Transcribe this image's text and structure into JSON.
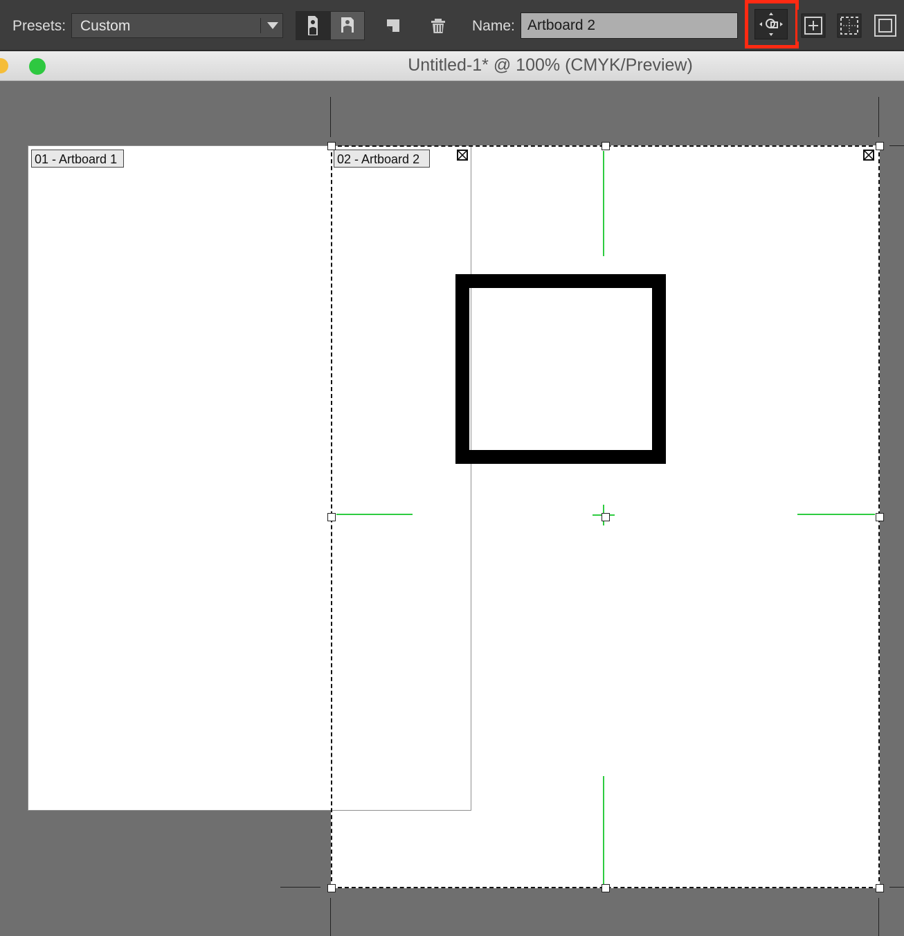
{
  "toolbar": {
    "presets_label": "Presets:",
    "presets_value": "Custom",
    "name_label": "Name:",
    "name_value": "Artboard 2",
    "highlight_color": "#ff2a12",
    "orientation_buttons": [
      "portrait-icon",
      "landscape-icon"
    ],
    "tools": [
      "new-artboard-icon",
      "delete-artboard-icon",
      "move-artwork-icon",
      "center-icon",
      "crosshair-icon",
      "video-safe-icon"
    ]
  },
  "document": {
    "title": "Untitled-1* @ 100% (CMYK/Preview)"
  },
  "artboards": [
    {
      "label": "01 - Artboard 1"
    },
    {
      "label": "02 - Artboard 2"
    }
  ],
  "colors": {
    "canvas": "#6f6f6f",
    "guide": "#2ecc40"
  }
}
